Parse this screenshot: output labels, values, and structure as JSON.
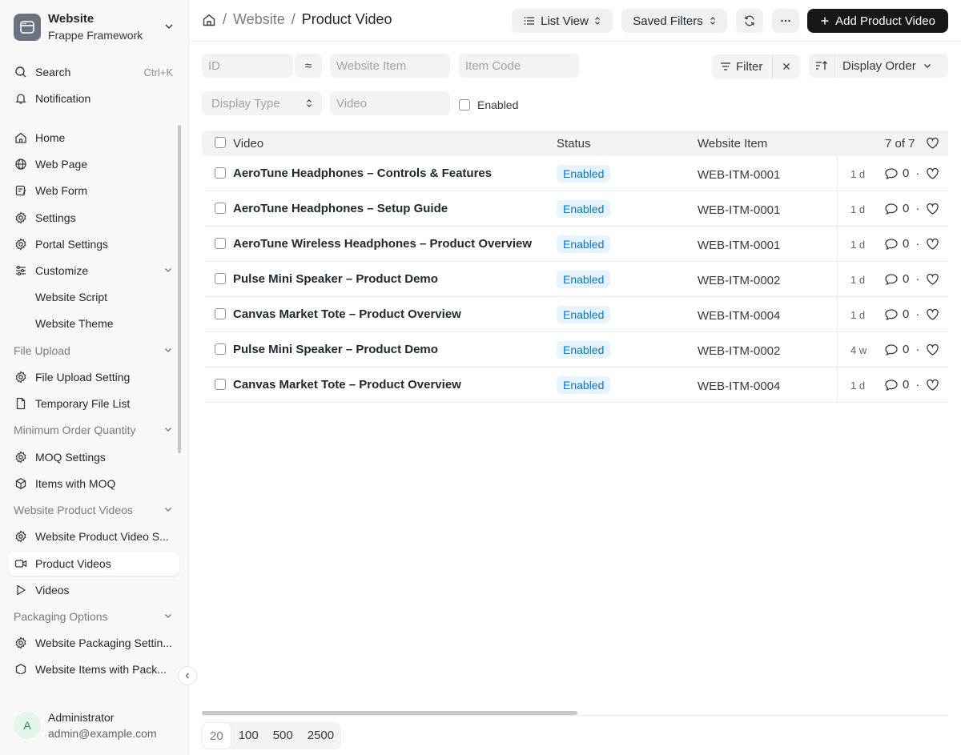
{
  "workspace": {
    "title": "Website",
    "subtitle": "Frappe Framework"
  },
  "sidebar": {
    "search": {
      "label": "Search",
      "shortcut": "Ctrl+K"
    },
    "notification": {
      "label": "Notification"
    },
    "items": [
      {
        "label": "Home",
        "icon": "home-icon"
      },
      {
        "label": "Web Page",
        "icon": "globe-icon"
      },
      {
        "label": "Web Form",
        "icon": "form-icon"
      },
      {
        "label": "Settings",
        "icon": "gear-icon"
      },
      {
        "label": "Portal Settings",
        "icon": "gear-icon"
      },
      {
        "label": "Customize",
        "icon": "sliders-icon"
      },
      {
        "label": "Website Script"
      },
      {
        "label": "Website Theme"
      },
      {
        "label": "File Upload"
      },
      {
        "label": "File Upload Setting",
        "icon": "gear-icon"
      },
      {
        "label": "Temporary File List",
        "icon": "file-icon"
      },
      {
        "label": "Minimum Order Quantity"
      },
      {
        "label": "MOQ Settings",
        "icon": "gear-icon"
      },
      {
        "label": "Items with MOQ",
        "icon": "box-icon"
      },
      {
        "label": "Website Product Videos"
      },
      {
        "label": "Website Product Video S...",
        "icon": "gear-icon"
      },
      {
        "label": "Product Videos",
        "icon": "video-icon"
      },
      {
        "label": "Videos",
        "icon": "play-icon"
      },
      {
        "label": "Packaging Options"
      },
      {
        "label": "Website Packaging Settin...",
        "icon": "gear-icon"
      },
      {
        "label": "Website Items with Pack...",
        "icon": "box-icon"
      }
    ]
  },
  "user": {
    "initial": "A",
    "name": "Administrator",
    "email": "admin@example.com"
  },
  "breadcrumb": {
    "parent": "Website",
    "current": "Product Video"
  },
  "toolbar": {
    "list_view": "List View",
    "saved_filters": "Saved Filters",
    "add_label": "Add Product Video"
  },
  "filters": {
    "id_placeholder": "ID",
    "website_item_placeholder": "Website Item",
    "item_code_placeholder": "Item Code",
    "display_type_placeholder": "Display Type",
    "video_placeholder": "Video",
    "enabled_label": "Enabled",
    "filter_label": "Filter",
    "sort_label": "Display Order"
  },
  "table": {
    "headers": {
      "video": "Video",
      "status": "Status",
      "website_item": "Website Item",
      "count": "7 of 7"
    },
    "rows": [
      {
        "video": "AeroTune Headphones – Controls & Features",
        "status": "Enabled",
        "website_item": "WEB-ITM-0001",
        "age": "1 d",
        "comments": "0"
      },
      {
        "video": "AeroTune Headphones – Setup Guide",
        "status": "Enabled",
        "website_item": "WEB-ITM-0001",
        "age": "1 d",
        "comments": "0"
      },
      {
        "video": "AeroTune Wireless Headphones – Product Overview",
        "status": "Enabled",
        "website_item": "WEB-ITM-0001",
        "age": "1 d",
        "comments": "0"
      },
      {
        "video": "Pulse Mini Speaker – Product Demo",
        "status": "Enabled",
        "website_item": "WEB-ITM-0002",
        "age": "1 d",
        "comments": "0"
      },
      {
        "video": "Canvas Market Tote – Product Overview",
        "status": "Enabled",
        "website_item": "WEB-ITM-0004",
        "age": "1 d",
        "comments": "0"
      },
      {
        "video": "Pulse Mini Speaker – Product Demo",
        "status": "Enabled",
        "website_item": "WEB-ITM-0002",
        "age": "4 w",
        "comments": "0"
      },
      {
        "video": "Canvas Market Tote – Product Overview",
        "status": "Enabled",
        "website_item": "WEB-ITM-0004",
        "age": "1 d",
        "comments": "0"
      }
    ]
  },
  "pager": {
    "sizes": [
      "20",
      "100",
      "500",
      "2500"
    ],
    "selected": "20"
  },
  "colors": {
    "primary_button": "#171717",
    "status_badge_bg": "#e6f4ff",
    "status_badge_text": "#0b77c9"
  }
}
